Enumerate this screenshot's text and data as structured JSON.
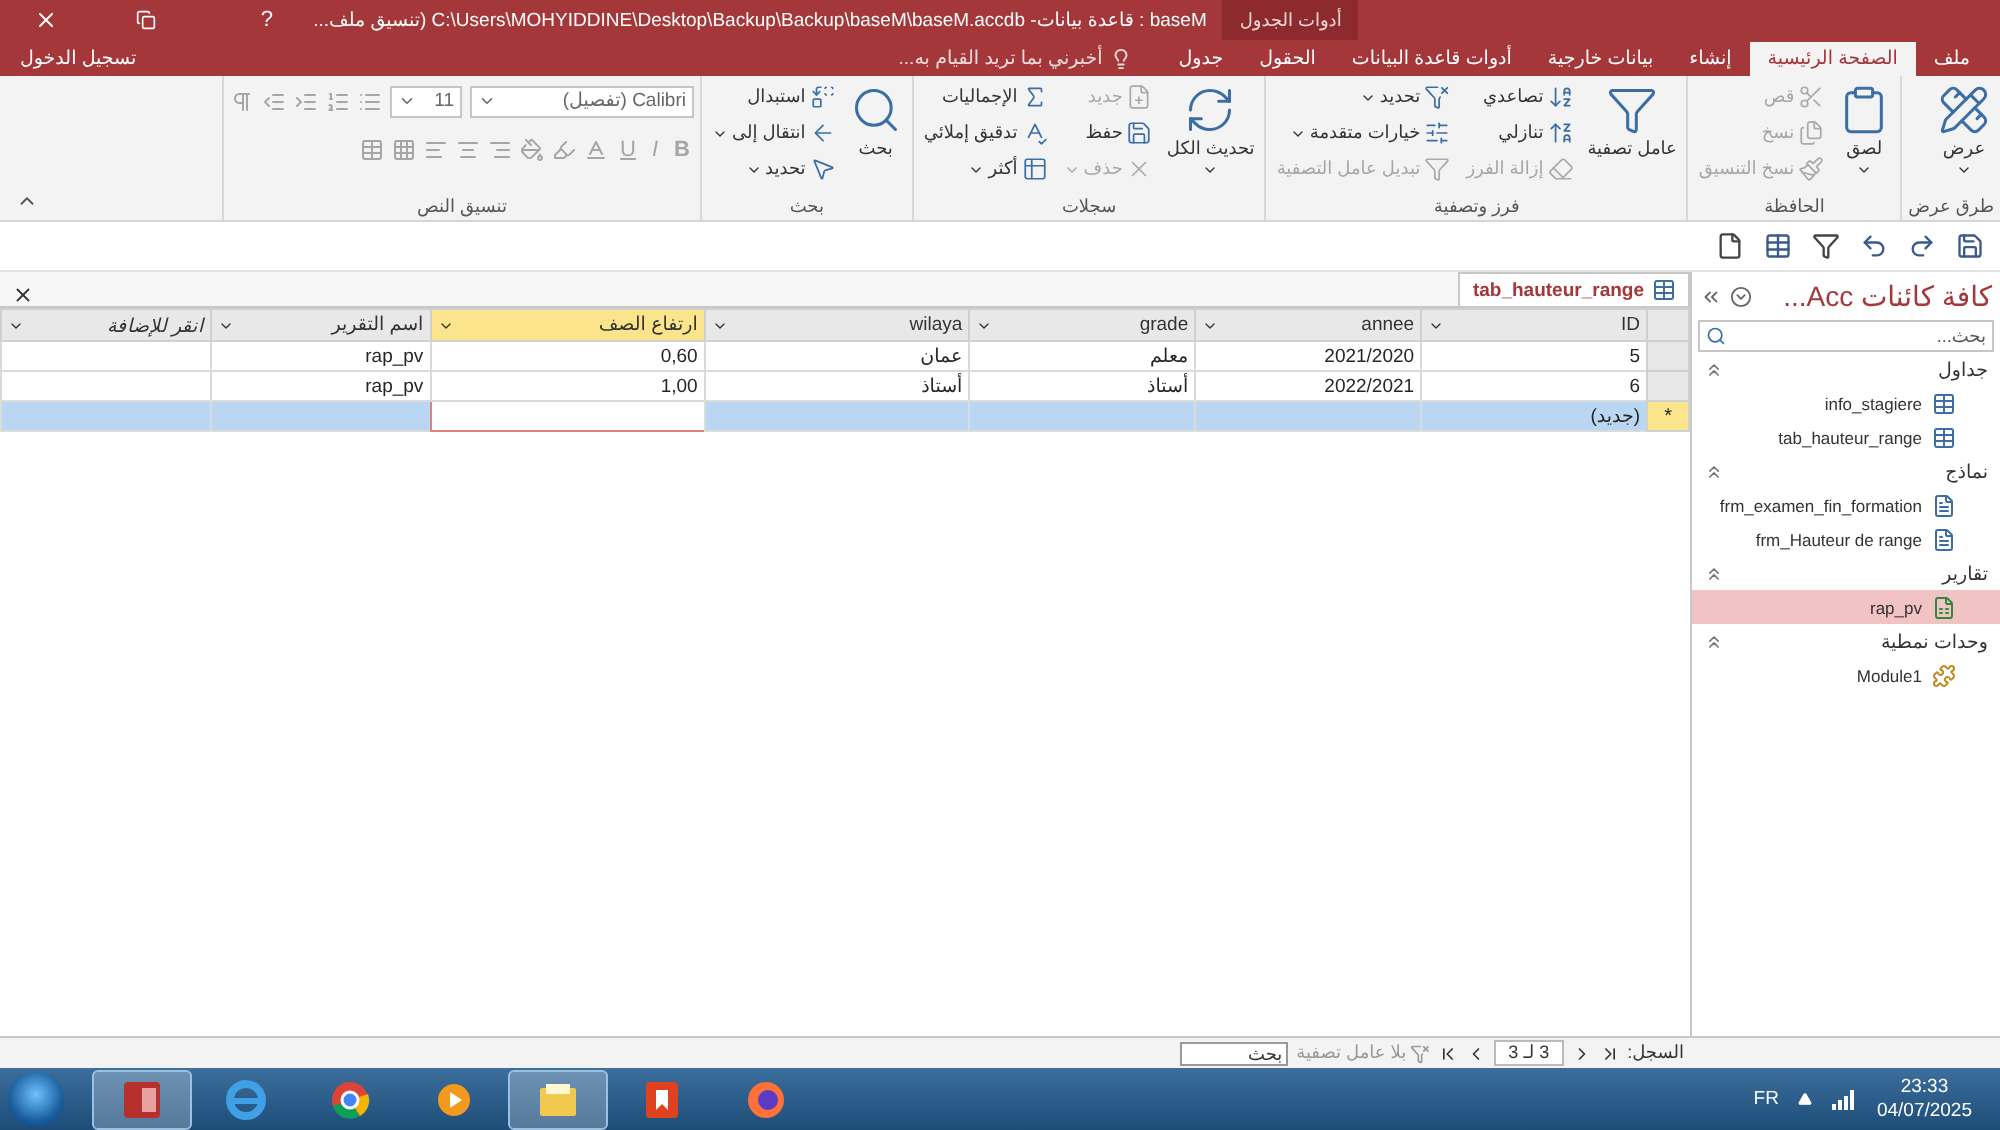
{
  "window": {
    "title": "baseM : قاعدة بيانات- C:\\Users\\MOHYIDDINE\\Desktop\\Backup\\Backup\\baseM\\baseM.accdb (تنسيق ملف...",
    "contextual_header": "أدوات الجدول",
    "help": "?"
  },
  "ribbon_tabs": [
    {
      "label": "ملف",
      "selected": false
    },
    {
      "label": "الصفحة الرئيسية",
      "selected": true
    },
    {
      "label": "إنشاء",
      "selected": false
    },
    {
      "label": "بيانات خارجية",
      "selected": false
    },
    {
      "label": "أدوات قاعدة البيانات",
      "selected": false
    },
    {
      "label": "الحقول",
      "selected": false
    },
    {
      "label": "جدول",
      "selected": false
    }
  ],
  "tell_me": {
    "placeholder": "أخبرني بما تريد القيام به..."
  },
  "sign_in": "تسجيل الدخول",
  "ribbon_groups": [
    {
      "label": "طرق عرض",
      "kind": "commands",
      "commands": [
        {
          "label": "عرض",
          "kind": "large",
          "dropdown": true,
          "disabled": false
        }
      ]
    },
    {
      "label": "الحافظة",
      "kind": "commands",
      "commands": [
        {
          "label": "لصق",
          "kind": "large",
          "dropdown": true,
          "disabled": false
        },
        {
          "label": "قص",
          "kind": "small",
          "dropdown": false,
          "disabled": true
        },
        {
          "label": "نسخ",
          "kind": "small",
          "dropdown": false,
          "disabled": true
        },
        {
          "label": "نسخ التنسيق",
          "kind": "small",
          "dropdown": false,
          "disabled": true
        }
      ]
    },
    {
      "label": "فرز وتصفية",
      "kind": "commands",
      "commands": [
        {
          "label": "عامل تصفية",
          "kind": "large",
          "dropdown": false,
          "disabled": false
        },
        {
          "label": "تصاعدي",
          "kind": "small",
          "dropdown": false,
          "disabled": false
        },
        {
          "label": "تنازلي",
          "kind": "small",
          "dropdown": false,
          "disabled": false
        },
        {
          "label": "إزالة الفرز",
          "kind": "small",
          "dropdown": false,
          "disabled": true
        },
        {
          "label": "تحديد",
          "kind": "small",
          "dropdown": true,
          "disabled": false
        },
        {
          "label": "خيارات متقدمة",
          "kind": "small",
          "dropdown": true,
          "disabled": false
        },
        {
          "label": "تبديل عامل التصفية",
          "kind": "small",
          "dropdown": false,
          "disabled": true
        }
      ]
    },
    {
      "label": "سجلات",
      "kind": "commands",
      "commands": [
        {
          "label": "تحديث الكل",
          "kind": "large",
          "dropdown": true,
          "disabled": false
        },
        {
          "label": "جديد",
          "kind": "small",
          "dropdown": false,
          "disabled": true
        },
        {
          "label": "حفظ",
          "kind": "small",
          "dropdown": false,
          "disabled": false
        },
        {
          "label": "حذف",
          "kind": "small",
          "dropdown": true,
          "disabled": true
        },
        {
          "label": "الإجماليات",
          "kind": "small",
          "dropdown": false,
          "disabled": false
        },
        {
          "label": "تدقيق إملائي",
          "kind": "small",
          "dropdown": false,
          "disabled": false
        },
        {
          "label": "أكثر",
          "kind": "small",
          "dropdown": true,
          "disabled": false
        }
      ]
    },
    {
      "label": "بحث",
      "kind": "commands",
      "commands": [
        {
          "label": "بحث",
          "kind": "large",
          "dropdown": false,
          "disabled": false
        },
        {
          "label": "استبدال",
          "kind": "small",
          "dropdown": false,
          "disabled": false
        },
        {
          "label": "انتقال إلى",
          "kind": "small",
          "dropdown": true,
          "disabled": false
        },
        {
          "label": "تحديد",
          "kind": "small",
          "dropdown": true,
          "disabled": false
        }
      ]
    },
    {
      "label": "تنسيق النص",
      "kind": "text_format",
      "disabled": true,
      "font_name": "Calibri (تفصيل)",
      "font_size": "11",
      "format_buttons": [
        "B",
        "I",
        "U"
      ]
    }
  ],
  "document_tab": {
    "label": "tab_hauteur_range"
  },
  "datasheet": {
    "columns": [
      {
        "label": "ID",
        "selected": false
      },
      {
        "label": "annee",
        "selected": false
      },
      {
        "label": "grade",
        "selected": false
      },
      {
        "label": "wilaya",
        "selected": false
      },
      {
        "label": "ارتفاع الصف",
        "selected": true
      },
      {
        "label": "اسم التقرير",
        "selected": false
      },
      {
        "label": "انقر للإضافة",
        "selected": false
      }
    ],
    "rows": [
      {
        "kind": "record",
        "selected": false,
        "cells": [
          "5",
          "2021/2020",
          "معلم",
          "عمان",
          "0,60",
          "rap_pv"
        ]
      },
      {
        "kind": "record",
        "selected": false,
        "cells": [
          "6",
          "2022/2021",
          "أستاذ",
          "أستاذ",
          "1,00",
          "rap_pv"
        ]
      },
      {
        "kind": "new",
        "selected": true,
        "marker": "*",
        "cells": [
          "(جديد)"
        ]
      }
    ]
  },
  "nav_pane": {
    "title": "كافة كائنات Acc...",
    "search_placeholder": "بحث...",
    "groups": [
      {
        "label": "جداول",
        "expanded": true,
        "items": [
          {
            "label": "info_stagiere",
            "kind": "table",
            "selected": false
          },
          {
            "label": "tab_hauteur_range",
            "kind": "table",
            "selected": false
          }
        ]
      },
      {
        "label": "نماذج",
        "expanded": true,
        "items": [
          {
            "label": "frm_examen_fin_formation",
            "kind": "form",
            "selected": false
          },
          {
            "label": "frm_Hauteur de range",
            "kind": "form",
            "selected": false
          }
        ]
      },
      {
        "label": "تقارير",
        "expanded": true,
        "items": [
          {
            "label": "rap_pv",
            "kind": "report",
            "selected": true
          }
        ]
      },
      {
        "label": "وحدات نمطية",
        "expanded": true,
        "items": [
          {
            "label": "Module1",
            "kind": "module",
            "selected": false
          }
        ]
      }
    ]
  },
  "status_bar": {
    "record_label": "السجل:",
    "record_position": "3 لـ 3",
    "filter": "بلا عامل تصفية",
    "search_placeholder": "بحث"
  },
  "taskbar": {
    "apps": [
      {
        "kind": "database",
        "active": true
      },
      {
        "kind": "ie",
        "active": false
      },
      {
        "kind": "chrome",
        "active": false
      },
      {
        "kind": "media",
        "active": false
      },
      {
        "kind": "explorer",
        "active": true
      },
      {
        "kind": "pdf",
        "active": false
      },
      {
        "kind": "firefox",
        "active": false
      }
    ],
    "language": "FR",
    "time": "23:33",
    "date": "04/07/2025"
  }
}
